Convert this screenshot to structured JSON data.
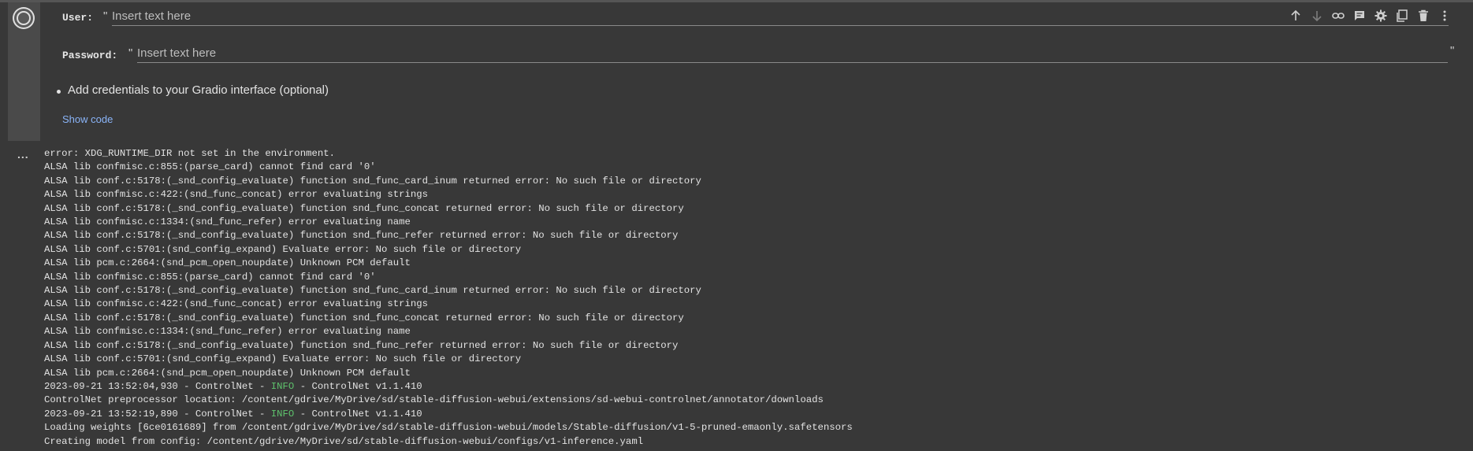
{
  "form": {
    "user_label": "User:",
    "user_placeholder": "Insert text here",
    "password_label": "Password:",
    "password_placeholder": "Insert text here",
    "quote_glyph": "\"",
    "bullet_text": "Add credentials to your Gradio interface (optional)",
    "show_code_label": "Show code"
  },
  "toolbar": {
    "icons": [
      "arrow-up-icon",
      "arrow-down-icon",
      "link-icon",
      "comment-icon",
      "gear-icon",
      "mirror-cell-icon",
      "trash-icon",
      "more-vert-icon"
    ]
  },
  "output": {
    "collapse_label": "...",
    "lines": [
      {
        "text": "error: XDG_RUNTIME_DIR not set in the environment."
      },
      {
        "text": "ALSA lib confmisc.c:855:(parse_card) cannot find card '0'"
      },
      {
        "text": "ALSA lib conf.c:5178:(_snd_config_evaluate) function snd_func_card_inum returned error: No such file or directory"
      },
      {
        "text": "ALSA lib confmisc.c:422:(snd_func_concat) error evaluating strings"
      },
      {
        "text": "ALSA lib conf.c:5178:(_snd_config_evaluate) function snd_func_concat returned error: No such file or directory"
      },
      {
        "text": "ALSA lib confmisc.c:1334:(snd_func_refer) error evaluating name"
      },
      {
        "text": "ALSA lib conf.c:5178:(_snd_config_evaluate) function snd_func_refer returned error: No such file or directory"
      },
      {
        "text": "ALSA lib conf.c:5701:(snd_config_expand) Evaluate error: No such file or directory"
      },
      {
        "text": "ALSA lib pcm.c:2664:(snd_pcm_open_noupdate) Unknown PCM default"
      },
      {
        "text": "ALSA lib confmisc.c:855:(parse_card) cannot find card '0'"
      },
      {
        "text": "ALSA lib conf.c:5178:(_snd_config_evaluate) function snd_func_card_inum returned error: No such file or directory"
      },
      {
        "text": "ALSA lib confmisc.c:422:(snd_func_concat) error evaluating strings"
      },
      {
        "text": "ALSA lib conf.c:5178:(_snd_config_evaluate) function snd_func_concat returned error: No such file or directory"
      },
      {
        "text": "ALSA lib confmisc.c:1334:(snd_func_refer) error evaluating name"
      },
      {
        "text": "ALSA lib conf.c:5178:(_snd_config_evaluate) function snd_func_refer returned error: No such file or directory"
      },
      {
        "text": "ALSA lib conf.c:5701:(snd_config_expand) Evaluate error: No such file or directory"
      },
      {
        "text": "ALSA lib pcm.c:2664:(snd_pcm_open_noupdate) Unknown PCM default"
      },
      {
        "pre": "2023-09-21 13:52:04,930 - ControlNet - ",
        "level": "INFO",
        "post": " - ControlNet v1.1.410"
      },
      {
        "text": "ControlNet preprocessor location: /content/gdrive/MyDrive/sd/stable-diffusion-webui/extensions/sd-webui-controlnet/annotator/downloads"
      },
      {
        "pre": "2023-09-21 13:52:19,890 - ControlNet - ",
        "level": "INFO",
        "post": " - ControlNet v1.1.410"
      },
      {
        "text": "Loading weights [6ce0161689] from /content/gdrive/MyDrive/sd/stable-diffusion-webui/models/Stable-diffusion/v1-5-pruned-emaonly.safetensors"
      },
      {
        "text": "Creating model from config: /content/gdrive/MyDrive/sd/stable-diffusion-webui/configs/v1-inference.yaml"
      }
    ]
  }
}
